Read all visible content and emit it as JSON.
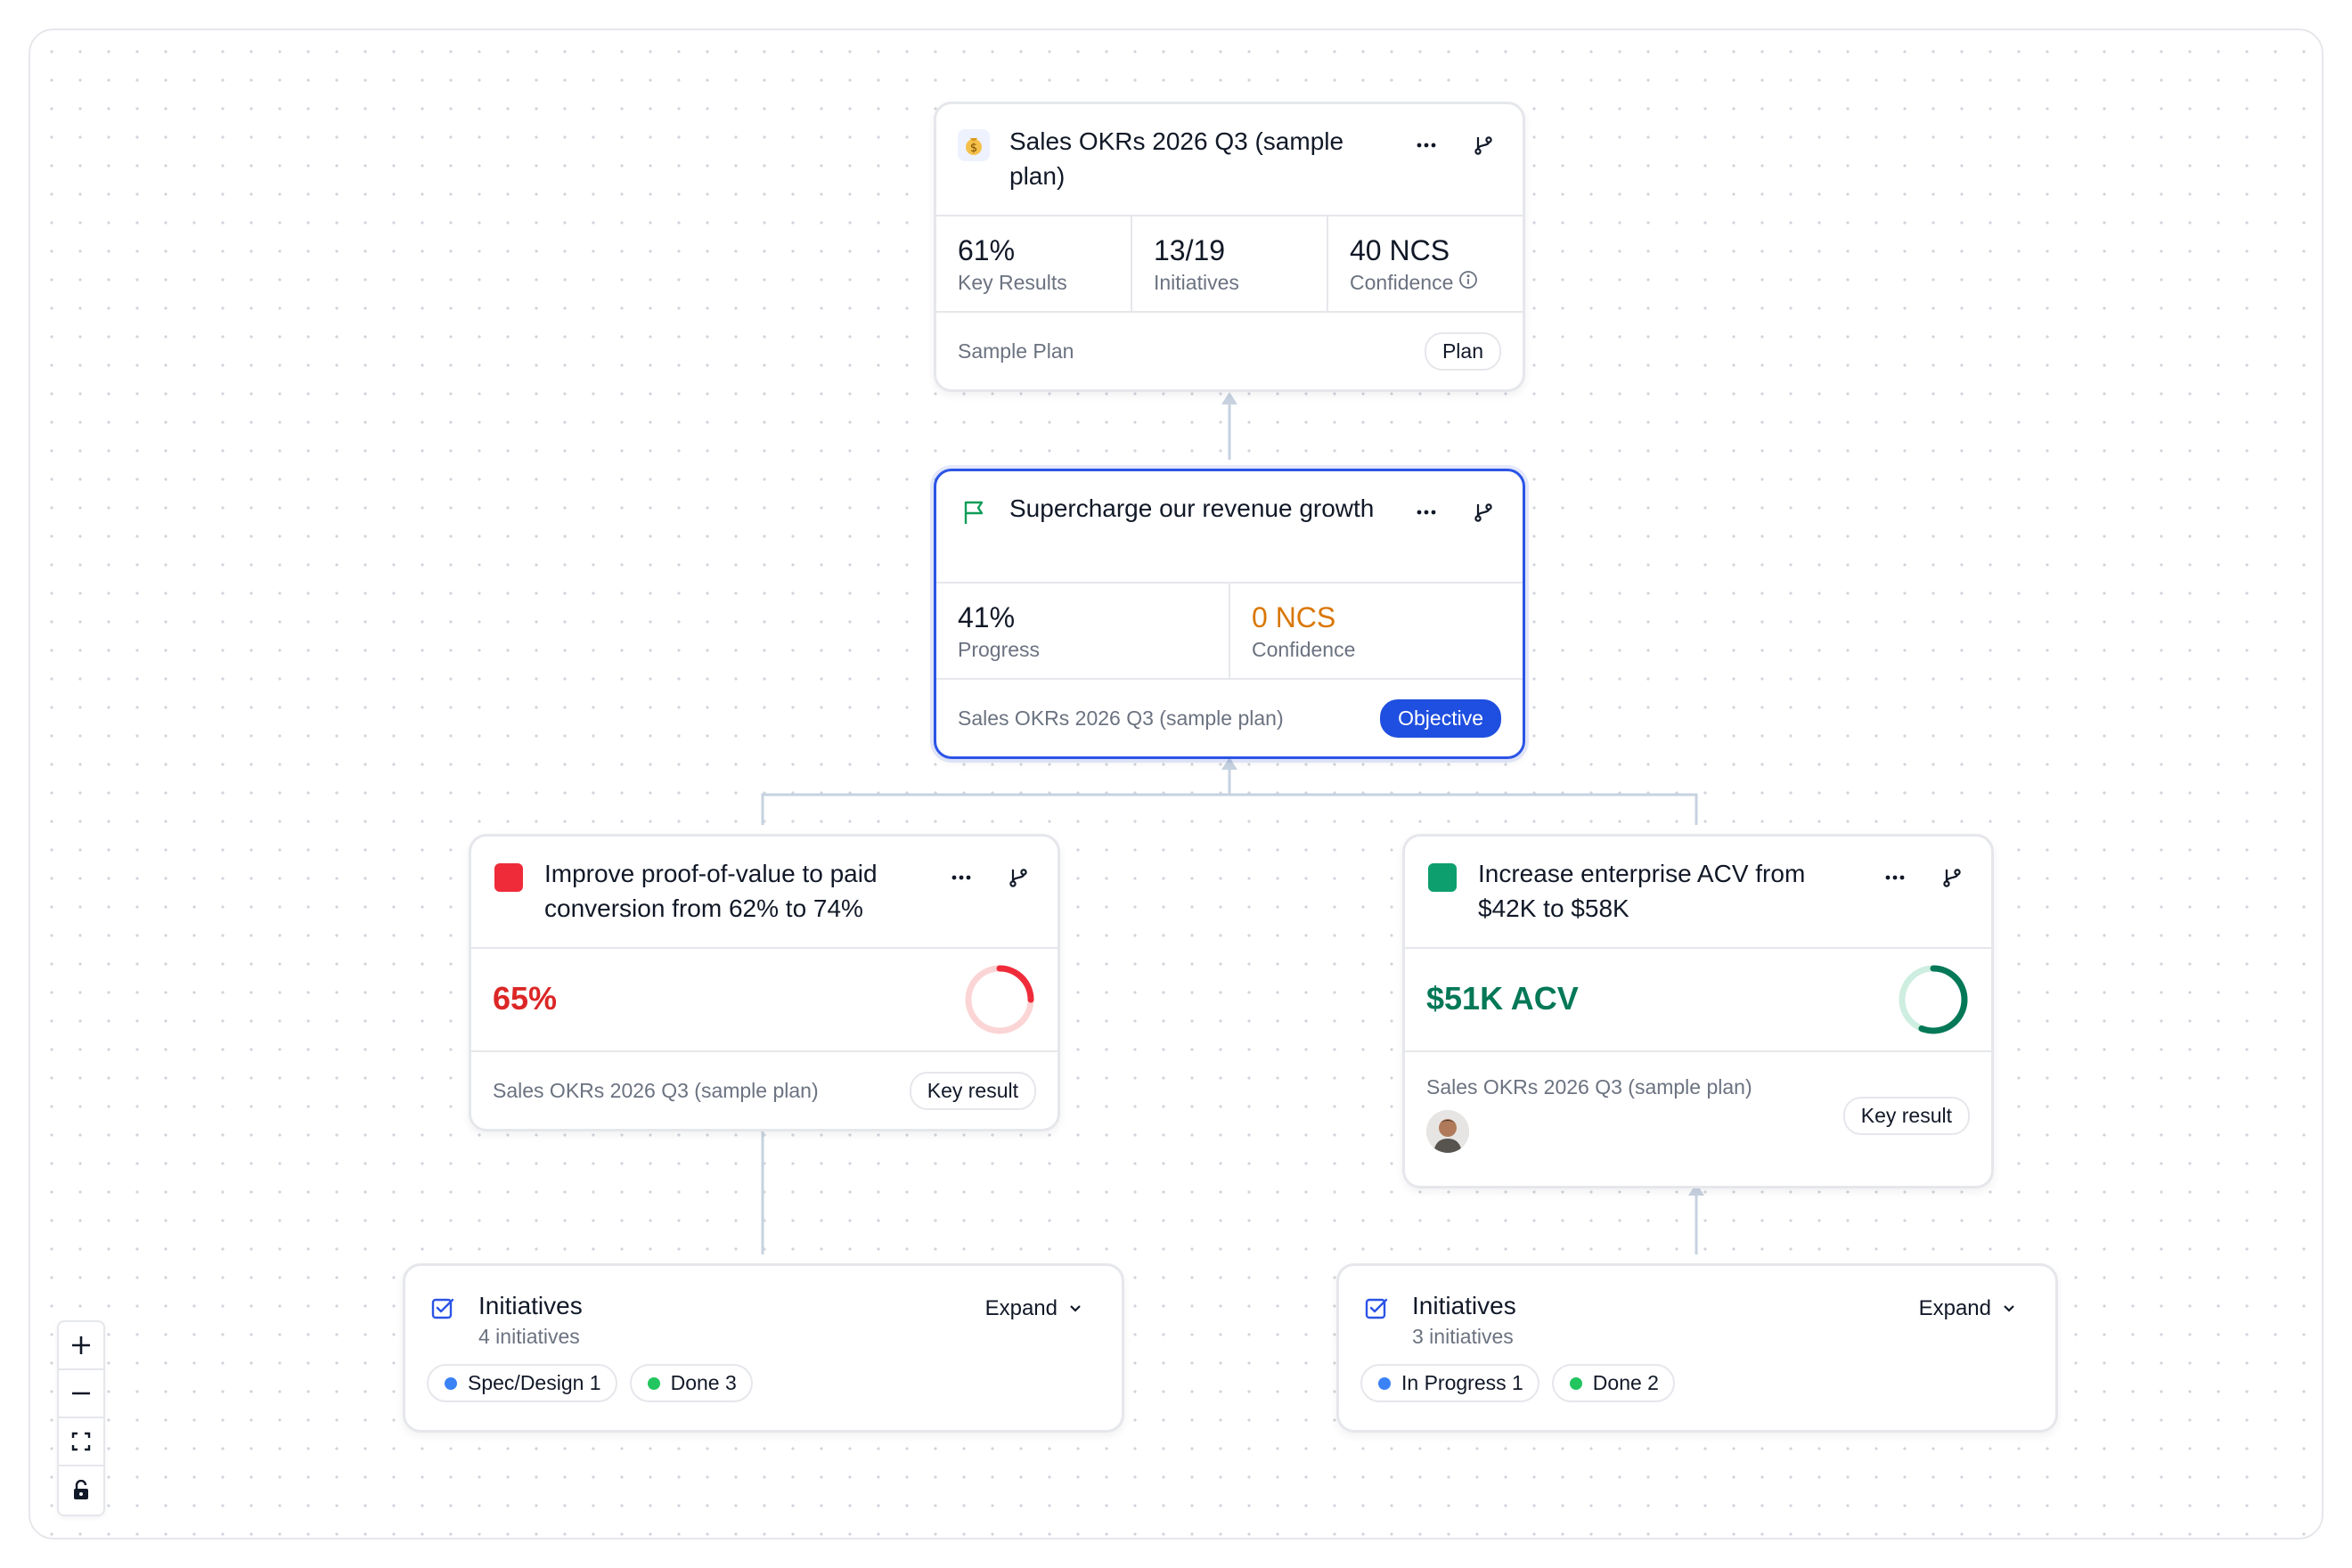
{
  "plan": {
    "title": "Sales OKRs 2026 Q3 (sample plan)",
    "icon": "money-bag-icon",
    "stats": [
      {
        "value": "61%",
        "label": "Key Results"
      },
      {
        "value": "13/19",
        "label": "Initiatives"
      },
      {
        "value": "40 NCS",
        "label": "Confidence"
      }
    ],
    "footer": "Sample Plan",
    "badge": "Plan"
  },
  "objective": {
    "title": "Supercharge our revenue growth",
    "icon": "flag-icon",
    "stats": [
      {
        "value": "41%",
        "label": "Progress"
      },
      {
        "value": "0 NCS",
        "label": "Confidence"
      }
    ],
    "footer": "Sales OKRs 2026 Q3 (sample plan)",
    "badge": "Objective",
    "confidence_color": "#d97706"
  },
  "key_results": [
    {
      "title": "Improve proof-of-value to paid conversion from 62% to 74%",
      "value": "65%",
      "color": "#dc2626",
      "progress": 0.25,
      "footer": "Sales OKRs 2026 Q3 (sample plan)",
      "badge": "Key result"
    },
    {
      "title": "Increase enterprise ACV from $42K to $58K",
      "value": "$51K ACV",
      "color": "#047857",
      "progress": 0.56,
      "footer": "Sales OKRs 2026 Q3 (sample plan)",
      "badge": "Key result"
    }
  ],
  "initiatives": [
    {
      "title": "Initiatives",
      "count": "4 initiatives",
      "expand": "Expand",
      "tags": [
        {
          "label": "Spec/Design 1",
          "color": "#3b82f6"
        },
        {
          "label": "Done 3",
          "color": "#22c55e"
        }
      ]
    },
    {
      "title": "Initiatives",
      "count": "3 initiatives",
      "expand": "Expand",
      "tags": [
        {
          "label": "In Progress 1",
          "color": "#3b82f6"
        },
        {
          "label": "Done 2",
          "color": "#22c55e"
        }
      ]
    }
  ],
  "controls": [
    "zoom-in-icon",
    "zoom-out-icon",
    "fit-view-icon",
    "lock-icon"
  ]
}
